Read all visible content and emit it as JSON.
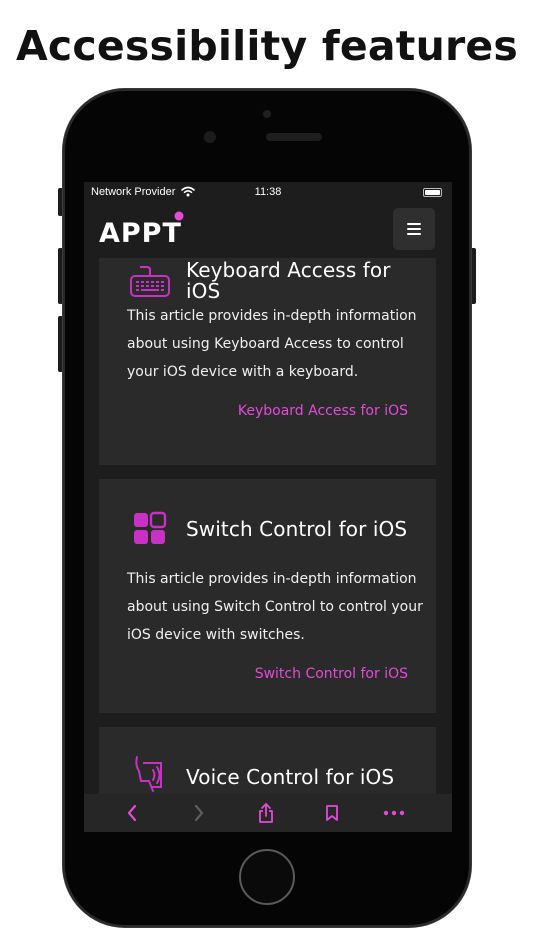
{
  "headline": "Accessibility features",
  "status_bar": {
    "carrier": "Network Provider",
    "time": "11:38"
  },
  "navbar": {
    "logo_text": "APPT",
    "menu_icon": "hamburger-icon"
  },
  "cards": [
    {
      "title": "Keyboard Access for iOS",
      "body": "This article provides in-depth information about using Keyboard Access to control your iOS device with a keyboard.",
      "link": "Keyboard Access for iOS",
      "icon": "keyboard-icon"
    },
    {
      "title": "Switch Control for iOS",
      "body": "This article provides in-depth information about using Switch Control to control your iOS device with switches.",
      "link": "Switch Control for iOS",
      "icon": "switch-grid-icon"
    },
    {
      "title": "Voice Control for iOS",
      "icon": "voice-control-icon"
    }
  ],
  "toolbar": {
    "items": [
      "back-chevron-icon",
      "forward-chevron-icon",
      "share-icon",
      "bookmark-icon",
      "more-dots-icon"
    ]
  },
  "colors": {
    "accent": "#e24bd8",
    "screen_bg": "#1d1d1d",
    "card_bg": "#2a2a2a"
  }
}
